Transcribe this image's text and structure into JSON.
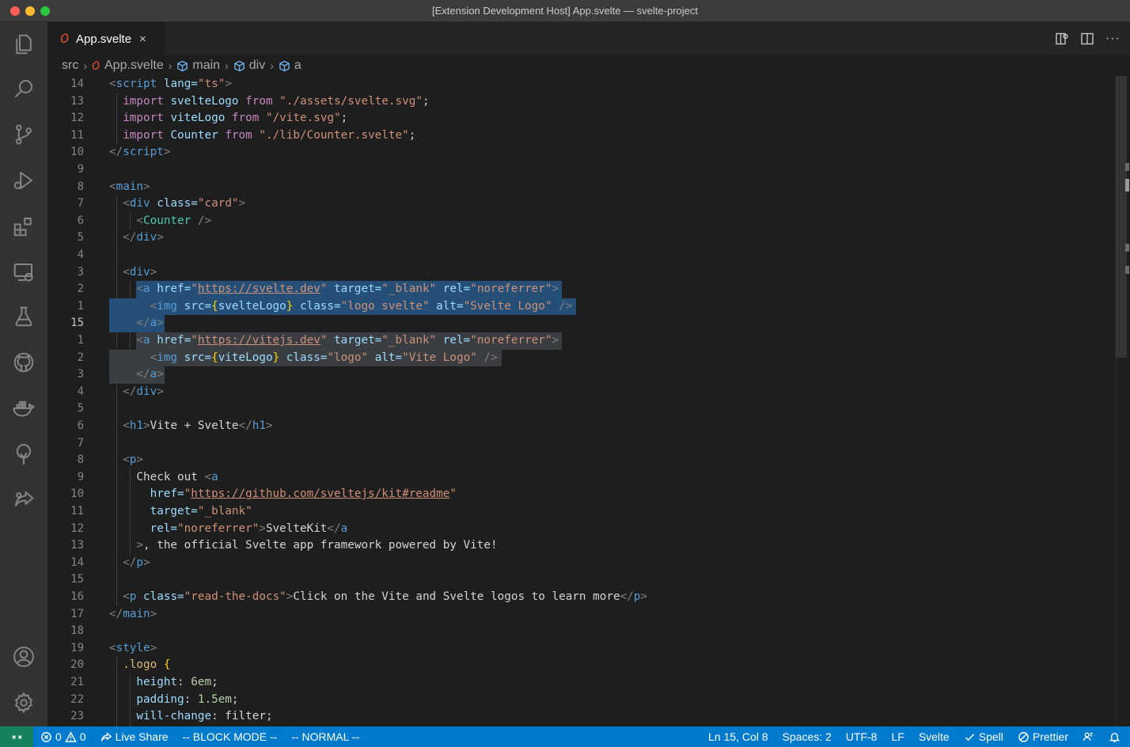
{
  "window": {
    "title": "[Extension Development Host] App.svelte — svelte-project"
  },
  "activity_bar": {
    "items": [
      "explorer-icon",
      "search-icon",
      "source-control-icon",
      "run-debug-icon",
      "extensions-icon",
      "remote-explorer-icon",
      "testing-icon",
      "github-icon",
      "docker-icon",
      "tree-icon",
      "live-share-icon"
    ],
    "bottom": [
      "account-icon",
      "settings-gear-icon"
    ]
  },
  "tab": {
    "label": "App.svelte",
    "close": "×"
  },
  "editor_actions": {
    "more": "···"
  },
  "breadcrumb": {
    "src": "src",
    "file": "App.svelte",
    "main": "main",
    "div": "div",
    "a": "a"
  },
  "colors": {
    "accent": "#007acc",
    "remote": "#16825d",
    "selection": "#264f78",
    "background": "#1e1e1e"
  },
  "gutter": [
    "14",
    "13",
    "12",
    "11",
    "10",
    "9",
    "8",
    "7",
    "6",
    "5",
    "4",
    "3",
    "2",
    "1",
    "15",
    "1",
    "2",
    "3",
    "4",
    "5",
    "6",
    "7",
    "8",
    "9",
    "10",
    "11",
    "12",
    "13",
    "14",
    "15",
    "16",
    "17",
    "18",
    "19",
    "20",
    "21",
    "22",
    "23"
  ],
  "code": {
    "l0": [
      "<",
      "script",
      " lang=",
      "\"ts\"",
      ">"
    ],
    "l1": [
      "import",
      " svelteLogo ",
      "from",
      " \"./assets/svelte.svg\"",
      ";"
    ],
    "l2": [
      "import",
      " viteLogo ",
      "from",
      " \"/vite.svg\"",
      ";"
    ],
    "l3": [
      "import",
      " Counter ",
      "from",
      " \"./lib/Counter.svelte\"",
      ";"
    ],
    "l4": [
      "</",
      "script",
      ">"
    ],
    "l6": [
      "<",
      "main",
      ">"
    ],
    "l7": [
      "<",
      "div",
      " class=",
      "\"card\"",
      ">"
    ],
    "l8": [
      "<",
      "Counter",
      " />"
    ],
    "l9": [
      "</",
      "div",
      ">"
    ],
    "l11": [
      "<",
      "div",
      ">"
    ],
    "l12": [
      "<",
      "a",
      " href=",
      "\"",
      "https://svelte.dev",
      "\"",
      " target=",
      "\"_blank\"",
      " rel=",
      "\"noreferrer\"",
      ">"
    ],
    "l13": [
      "<",
      "img",
      " src=",
      "{",
      "svelteLogo",
      "}",
      " class=",
      "\"logo svelte\"",
      " alt=",
      "\"Svelte Logo\"",
      " />"
    ],
    "l14": [
      "</",
      "a",
      ">"
    ],
    "l15": [
      "<",
      "a",
      " href=",
      "\"",
      "https://vitejs.dev",
      "\"",
      " target=",
      "\"_blank\"",
      " rel=",
      "\"noreferrer\"",
      ">"
    ],
    "l16": [
      "<",
      "img",
      " src=",
      "{",
      "viteLogo",
      "}",
      " class=",
      "\"logo\"",
      " alt=",
      "\"Vite Logo\"",
      " />"
    ],
    "l17": [
      "</",
      "a",
      ">"
    ],
    "l18": [
      "</",
      "div",
      ">"
    ],
    "l20": [
      "<",
      "h1",
      ">",
      "Vite + Svelte",
      "</",
      "h1",
      ">"
    ],
    "l22": [
      "<",
      "p",
      ">"
    ],
    "l23": [
      "Check out ",
      "<",
      "a"
    ],
    "l24": [
      "href=",
      "\"",
      "https://github.com/sveltejs/kit#readme",
      "\""
    ],
    "l25": [
      "target=",
      "\"_blank\""
    ],
    "l26": [
      "rel=",
      "\"noreferrer\"",
      ">",
      "SvelteKit",
      "</",
      "a"
    ],
    "l27": [
      ">",
      ", the official Svelte app framework powered by Vite!"
    ],
    "l28": [
      "</",
      "p",
      ">"
    ],
    "l30": [
      "<",
      "p",
      " class=",
      "\"read-the-docs\"",
      ">",
      "Click on the Vite and Svelte logos to learn more",
      "</",
      "p",
      ">"
    ],
    "l31": [
      "</",
      "main",
      ">"
    ],
    "l33": [
      "<",
      "style",
      ">"
    ],
    "l34": [
      ".logo",
      " {"
    ],
    "l35": [
      "height",
      ": ",
      "6em",
      ";"
    ],
    "l36": [
      "padding",
      ": ",
      "1.5em",
      ";"
    ],
    "l37": [
      "will-change",
      ": filter;"
    ]
  },
  "status_bar": {
    "errors": "0",
    "warnings": "0",
    "live_share": "Live Share",
    "block_mode": "-- BLOCK MODE --",
    "normal": "-- NORMAL --",
    "position": "Ln 15, Col 8",
    "spaces": "Spaces: 2",
    "encoding": "UTF-8",
    "eol": "LF",
    "language": "Svelte",
    "spell": "Spell",
    "prettier": "Prettier"
  }
}
